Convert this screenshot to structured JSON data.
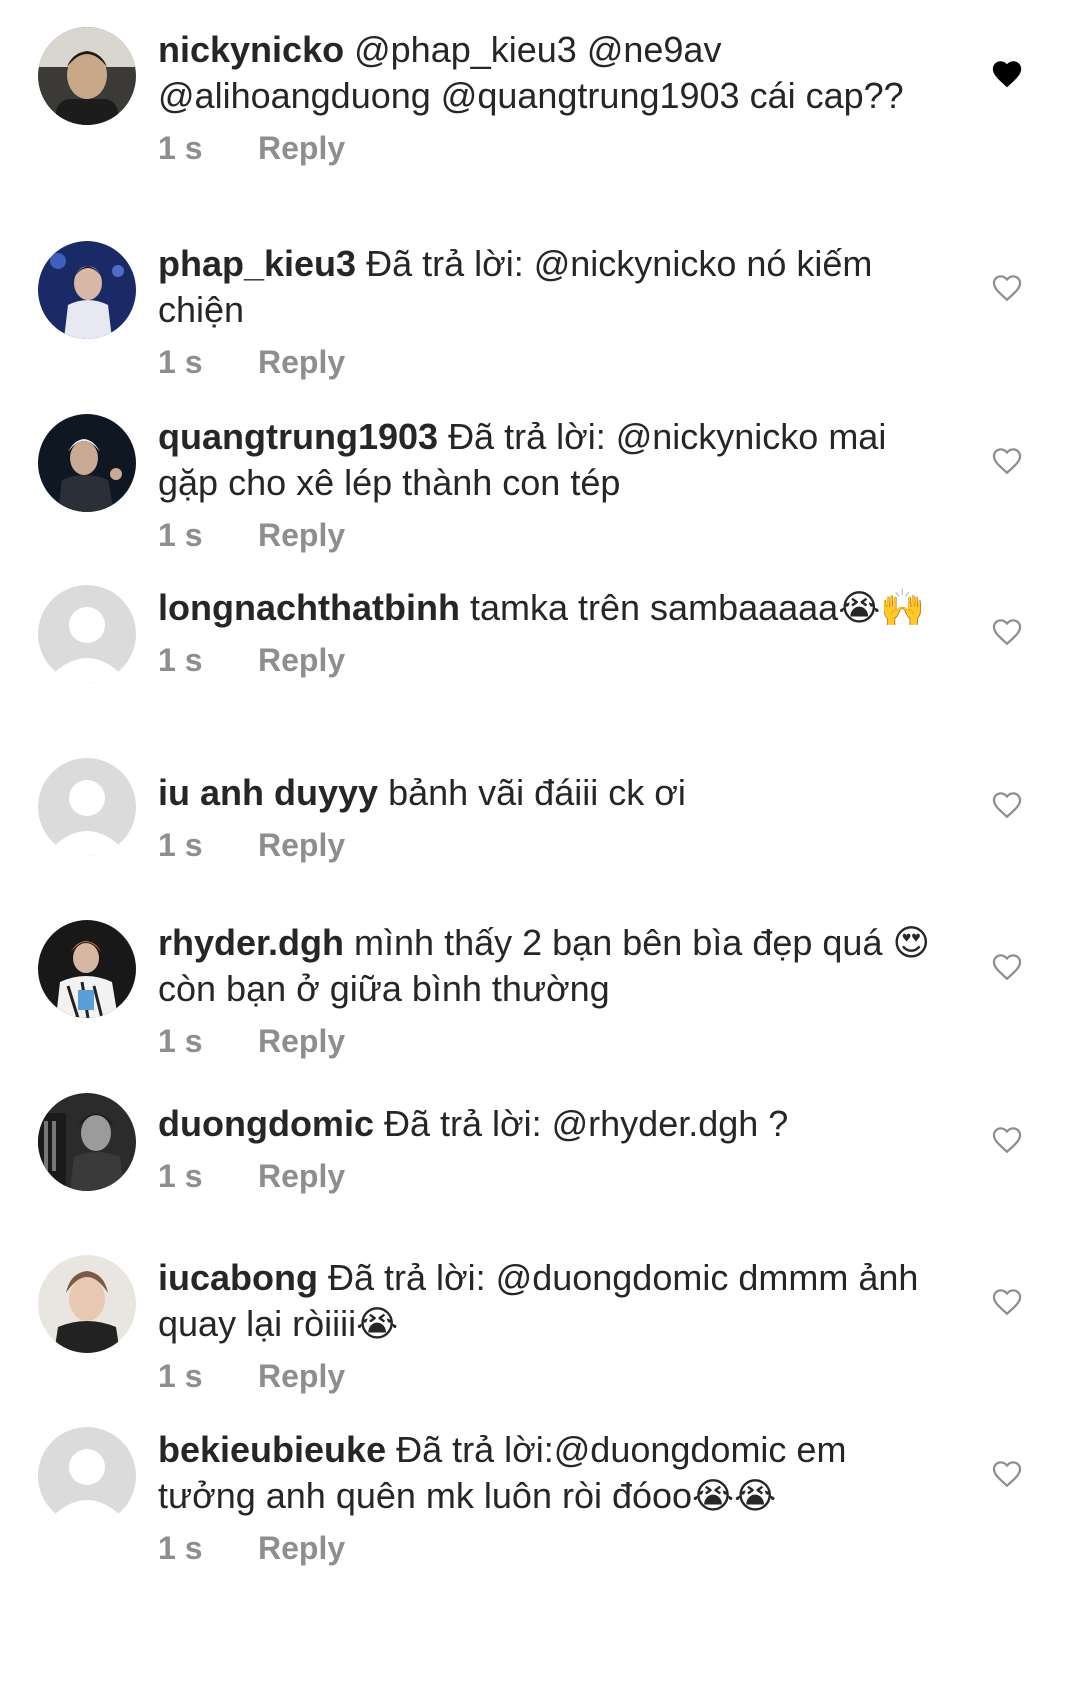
{
  "comments": [
    {
      "username": "nickynicko",
      "text": "@phap_kieu3 @ne9av @alihoangduong @quangtrung1903 cái cap??",
      "time": "1 s",
      "reply_label": "Reply",
      "liked": true,
      "avatar": "photo"
    },
    {
      "username": "phap_kieu3",
      "text": "Đã trả lời: @nickynicko nó kiếm chiện",
      "time": "1 s",
      "reply_label": "Reply",
      "liked": false,
      "avatar": "photo"
    },
    {
      "username": "quangtrung1903",
      "text": "Đã trả lời: @nickynicko mai gặp cho xê lép thành con tép",
      "time": "1 s",
      "reply_label": "Reply",
      "liked": false,
      "avatar": "photo"
    },
    {
      "username": "longnachthatbinh",
      "text": "tamka trên sambaaaaa😭🙌",
      "time": "1 s",
      "reply_label": "Reply",
      "liked": false,
      "avatar": "default"
    },
    {
      "username": "iu anh duyyy",
      "text": "bảnh vãi đáiii ck ơi",
      "time": "1 s",
      "reply_label": "Reply",
      "liked": false,
      "avatar": "default"
    },
    {
      "username": "rhyder.dgh",
      "text": "mình thấy 2 bạn bên bìa đẹp quá 😍 còn bạn ở giữa bình thường",
      "time": "1 s",
      "reply_label": "Reply",
      "liked": false,
      "avatar": "photo"
    },
    {
      "username": "duongdomic",
      "text": "Đã trả lời: @rhyder.dgh ?",
      "time": "1 s",
      "reply_label": "Reply",
      "liked": false,
      "avatar": "photo"
    },
    {
      "username": "iucabong",
      "text": "Đã trả lời: @duongdomic dmmm ảnh quay lại ròiiii😭",
      "time": "1 s",
      "reply_label": "Reply",
      "liked": false,
      "avatar": "photo"
    },
    {
      "username": "bekieubieuke",
      "text": "Đã trả lời:@duongdomic em tưởng anh quên mk luôn ròi đóoo😭😭",
      "time": "1 s",
      "reply_label": "Reply",
      "liked": false,
      "avatar": "default"
    }
  ],
  "colors": {
    "text": "#262626",
    "meta": "#8e8e8e",
    "heart_outline": "#8e8e8e",
    "heart_filled": "#000000",
    "avatar_default_bg": "#dbdbdb",
    "avatar_default_fg": "#ffffff"
  }
}
